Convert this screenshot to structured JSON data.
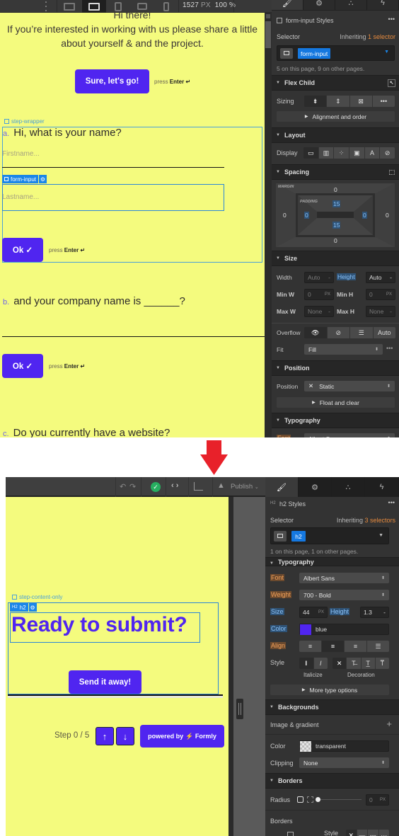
{
  "top_screen": {
    "toolbar": {
      "breakpoint_width": "1527",
      "breakpoint_unit": "PX",
      "zoom": "100 %",
      "devices": [
        "desktop-icon",
        "desktop-small-icon",
        "tablet-icon",
        "tablet-landscape-icon",
        "phone-icon"
      ]
    },
    "canvas": {
      "greeting": "Hi there!",
      "intro": "If you’re interested in working with us please share a little about yourself & and the project.",
      "start_button": "Sure, let's go!",
      "press_label": "press",
      "press_key": "Enter ↵",
      "step_wrapper_tag": "step-wrapper",
      "form_input_tag": "form-input",
      "questions": [
        {
          "letter": "a.",
          "text": "Hi, what is your name?"
        },
        {
          "letter": "b.",
          "text": "and your company name is ______?"
        },
        {
          "letter": "c.",
          "text": "Do you currently have a website?"
        }
      ],
      "firstname_placeholder": "Firstname...",
      "lastname_placeholder": "Lastname...",
      "ok_button": "Ok ✓"
    },
    "panel": {
      "tabs": [
        "brush-icon",
        "gear-icon",
        "drops-icon",
        "lightning-icon"
      ],
      "styles_title": "form-input Styles",
      "more": "•••",
      "selector_label": "Selector",
      "inheriting_prefix": "Inheriting",
      "inheriting_count": "1 selector",
      "selector_chip": "form-input",
      "usage": "5 on this page, 9 on other pages.",
      "flex_child": {
        "title": "Flex Child",
        "sizing_label": "Sizing",
        "sizing_options": [
          "shrink",
          "grow",
          "none",
          "•••"
        ],
        "alignment": "Alignment and order"
      },
      "layout": {
        "title": "Layout",
        "display_label": "Display",
        "display_options": [
          "block",
          "flex",
          "grid",
          "inline-block",
          "inline",
          "none"
        ]
      },
      "spacing": {
        "title": "Spacing",
        "margin_label": "MARGIN",
        "padding_label": "PADDING",
        "margin": {
          "top": "0",
          "right": "0",
          "bottom": "0",
          "left": "0"
        },
        "padding": {
          "top": "15",
          "right": "0",
          "bottom": "15",
          "left": "0"
        }
      },
      "size": {
        "title": "Size",
        "width_label": "Width",
        "width_value": "Auto",
        "height_label": "Height",
        "height_value": "Auto",
        "minw_label": "Min W",
        "minw_value": "0",
        "minh_label": "Min H",
        "minh_value": "0",
        "maxw_label": "Max W",
        "maxw_value": "None",
        "maxh_label": "Max H",
        "maxh_value": "None",
        "unit": "PX",
        "overflow_label": "Overflow",
        "overflow_options": [
          "visible",
          "hidden",
          "scroll",
          "Auto"
        ],
        "fit_label": "Fit",
        "fit_value": "Fill"
      },
      "position": {
        "title": "Position",
        "label": "Position",
        "value": "Static",
        "float": "Float and clear"
      },
      "typography": {
        "title": "Typography",
        "font_label": "Font",
        "font_value": "Albert Sans"
      }
    }
  },
  "bottom_screen": {
    "toolbar": {
      "publish": "Publish"
    },
    "canvas": {
      "step_content_tag": "step-content-only",
      "h2_tag": "h2",
      "heading": "Ready to submit?",
      "send_button": "Send it away!",
      "step_text": "Step 0 / 5",
      "up": "↑",
      "down": "↓",
      "powered_prefix": "powered by",
      "powered_brand": "⚡ Formly"
    },
    "panel": {
      "tabs": [
        "brush-icon",
        "gear-icon",
        "drops-icon",
        "lightning-icon"
      ],
      "styles_title": "h2 Styles",
      "selector_label": "Selector",
      "inheriting_prefix": "Inheriting",
      "inheriting_count": "3 selectors",
      "selector_chip": "h2",
      "usage": "1 on this page, 1 on other pages.",
      "typography": {
        "title": "Typography",
        "font_label": "Font",
        "font_value": "Albert Sans",
        "weight_label": "Weight",
        "weight_value": "700 - Bold",
        "size_label": "Size",
        "size_value": "44",
        "size_unit": "PX",
        "height_label": "Height",
        "height_value": "1.3",
        "color_label": "Color",
        "color_value": "blue",
        "color_hex": "#5025f0",
        "align_label": "Align",
        "style_label": "Style",
        "italicize_label": "Italicize",
        "decoration_label": "Decoration",
        "more": "More type options"
      },
      "backgrounds": {
        "title": "Backgrounds",
        "image_gradient": "Image & gradient",
        "color_label": "Color",
        "color_value": "transparent",
        "clipping_label": "Clipping",
        "clipping_value": "None"
      },
      "borders": {
        "title": "Borders",
        "radius_label": "Radius",
        "radius_value": "0",
        "radius_unit": "PX",
        "borders_label": "Borders",
        "style_label": "Style"
      }
    }
  },
  "colors": {
    "canvas_bg": "#f4fb7e",
    "brand_purple": "#5025f0",
    "selection_blue": "#1a86e8",
    "inherit_orange": "#e58a3e",
    "arrow_red": "#e8212a"
  }
}
